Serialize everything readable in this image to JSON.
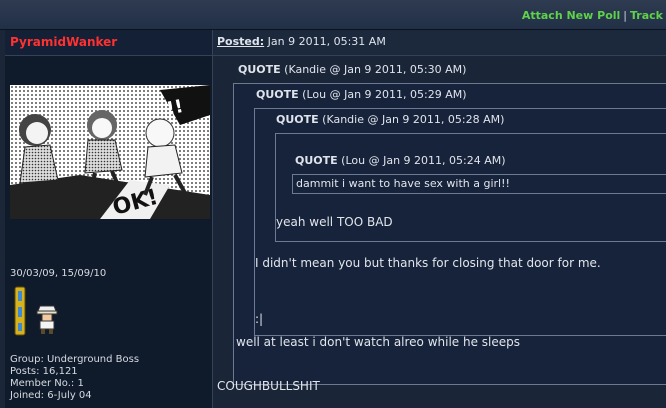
{
  "topbar": {
    "attach_poll": "Attach New Poll",
    "separator": "|",
    "track": "Track"
  },
  "user": {
    "name": "PyramidWanker",
    "dates": "30/03/09, 15/09/10",
    "group": "Group: Underground Boss",
    "posts": "Posts: 16,121",
    "member_no": "Member No.: 1",
    "joined": "Joined: 6-July 04"
  },
  "post": {
    "posted_label": "Posted:",
    "posted_date": "Jan 9 2011, 05:31 AM",
    "quotes": [
      {
        "label": "QUOTE",
        "meta": "(Kandie @ Jan 9 2011, 05:30 AM)"
      },
      {
        "label": "QUOTE",
        "meta": "(Lou @ Jan 9 2011, 05:29 AM)"
      },
      {
        "label": "QUOTE",
        "meta": "(Kandie @ Jan 9 2011, 05:28 AM)"
      },
      {
        "label": "QUOTE",
        "meta": "(Lou @ Jan 9 2011, 05:24 AM)"
      }
    ],
    "q4_text": "dammit i want to have sex with a girl!!",
    "q3_text": "yeah well TOO BAD",
    "q2_text": "I didn't mean you but thanks for closing that door for me.",
    "q2_emote": ":|",
    "q1_text": "well at least i don't watch alreo while he sleeps",
    "body": "COUGHBULLSHIT"
  },
  "colors": {
    "username": "#ff3131",
    "links": "#5fd14a",
    "background": "#1b2738"
  }
}
